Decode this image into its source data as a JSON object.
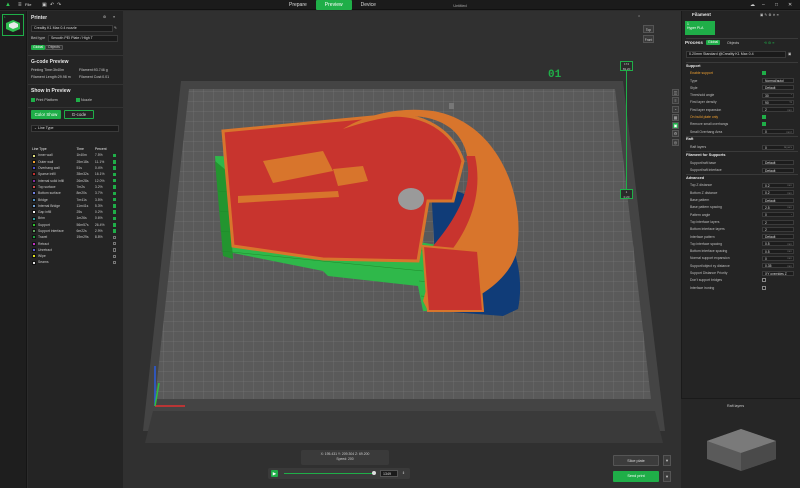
{
  "topbar": {
    "logo": "▲",
    "menu_icon": "≡",
    "file_label": "File",
    "tabs": [
      {
        "label": "Prepare",
        "active": false
      },
      {
        "label": "Preview",
        "active": true
      },
      {
        "label": "Device",
        "active": false
      }
    ],
    "document_title": "Untitled",
    "accent": "#1fae48"
  },
  "left": {
    "plate_thumb_number": "1",
    "printer_title": "Printer",
    "printer_name": "Creality K1 Max 0.4 nozzle",
    "bed_type_label": "Bed type",
    "bed_type_value": "Smooth PEI Plate / High T",
    "global_tab": "Global",
    "objects_tab": "Objects",
    "gcode_title": "G-code Preview",
    "printing_time": "Printing Time:3h40m",
    "filament_weight": "Filament:93.746 g",
    "filament_length": "Filament Length:29.98 m",
    "filament_cost": "Filament Cost:0.01",
    "show_title": "Show in Preview",
    "print_platform": "Print Platform",
    "nozzle": "Nozzle",
    "color_scheme": "Color Show",
    "gcode_btn": "G-code",
    "line_type_label": "Line Type",
    "legend_headers": {
      "type": "Line Type",
      "time": "Time",
      "percent": "Percent"
    },
    "legend": [
      {
        "name": "Inner wall",
        "time": "1h40m",
        "percent": "7.5%",
        "color": "#e0e080",
        "on": true
      },
      {
        "name": "Outer wall",
        "time": "25m18s",
        "percent": "11.1%",
        "color": "#f0a030",
        "on": true
      },
      {
        "name": "Overhang wall",
        "time": "51s",
        "percent": "0.4%",
        "color": "#5050c8",
        "on": true
      },
      {
        "name": "Sparse infill",
        "time": "35m32s",
        "percent": "16.1%",
        "color": "#c03030",
        "on": true
      },
      {
        "name": "Internal solid infill",
        "time": "26m28s",
        "percent": "12.0%",
        "color": "#8030a0",
        "on": true
      },
      {
        "name": "Top surface",
        "time": "7m2s",
        "percent": "3.2%",
        "color": "#d05050",
        "on": true
      },
      {
        "name": "Bottom surface",
        "time": "8m20s",
        "percent": "3.7%",
        "color": "#7080e0",
        "on": true
      },
      {
        "name": "Bridge",
        "time": "7m41s",
        "percent": "3.5%",
        "color": "#5090c0",
        "on": true
      },
      {
        "name": "Internal Bridge",
        "time": "11m41s",
        "percent": "5.3%",
        "color": "#70a0d0",
        "on": true
      },
      {
        "name": "Gap infill",
        "time": "25s",
        "percent": "0.2%",
        "color": "#f0f0f0",
        "on": true
      },
      {
        "name": "Brim",
        "time": "1m26s",
        "percent": "0.6%",
        "color": "#30a0a0",
        "on": true
      },
      {
        "name": "Support",
        "time": "56m57s",
        "percent": "26.4%",
        "color": "#30c030",
        "on": true
      },
      {
        "name": "Support interface",
        "time": "6m22s",
        "percent": "2.9%",
        "color": "#60a060",
        "on": true
      },
      {
        "name": "Travel",
        "time": "19m29s",
        "percent": "8.8%",
        "color": "#20a040",
        "on": false
      },
      {
        "name": "Retract",
        "time": "",
        "percent": "",
        "color": "#c030c0",
        "on": false
      },
      {
        "name": "Unretract",
        "time": "",
        "percent": "",
        "color": "#6060d0",
        "on": false
      },
      {
        "name": "Wipe",
        "time": "",
        "percent": "",
        "color": "#e0e020",
        "on": false
      },
      {
        "name": "Seams",
        "time": "",
        "percent": "",
        "color": "#e0e0e0",
        "on": false
      }
    ]
  },
  "viewport": {
    "plate_number": "01",
    "top_label": "Top",
    "front_label": "Front",
    "layer_top_count": "174",
    "layer_top_height": "69.20",
    "layer_bottom_count": "1",
    "layer_bottom_height": "0.20",
    "coords": "X: 195.431  Y: 209.304  Z: 69.200",
    "speed": "Speed: 200",
    "move_value": "1349",
    "slice_btn": "Slice plate",
    "print_btn": "Send print"
  },
  "right": {
    "filament_title": "Filament",
    "filament_chip_num": "1",
    "filament_chip_name": "Hyper PLA",
    "process_title": "Process",
    "global_tab": "Global",
    "objects_tab": "Objects",
    "process_preset": "0.20mm Standard @Creality K1 Max 0.4",
    "sections": {
      "support": "Support",
      "raft": "Raft",
      "filament_supports": "Filament for Supports",
      "advanced": "Advanced"
    },
    "rows": {
      "enable_support": "Enable support",
      "type": "Type",
      "type_val": "Normal(auto)",
      "style": "Style",
      "style_val": "Default",
      "threshold": "Threshold angle",
      "threshold_val": "30",
      "first_layer_density": "First layer density",
      "first_layer_density_val": "90",
      "first_layer_expansion": "First layer expansion",
      "first_layer_expansion_val": "2",
      "on_build_plate": "On build plate only",
      "remove_small": "Remove small overhangs",
      "small_overhang": "Small Overhang Area",
      "small_overhang_val": "0",
      "raft_layers": "Raft layers",
      "raft_layers_val": "0",
      "support_base": "Support/raft base",
      "support_base_val": "Default",
      "support_interface": "Support/raft interface",
      "support_interface_val": "Default",
      "top_z": "Top Z distance",
      "top_z_val": "0.2",
      "bottom_z": "Bottom Z distance",
      "bottom_z_val": "0.2",
      "base_pattern": "Base pattern",
      "base_pattern_val": "Default",
      "base_spacing": "Base pattern spacing",
      "base_spacing_val": "2.5",
      "pattern_angle": "Pattern angle",
      "pattern_angle_val": "0",
      "top_if_layers": "Top interface layers",
      "top_if_layers_val": "2",
      "bottom_if_layers": "Bottom interface layers",
      "bottom_if_layers_val": "2",
      "if_pattern": "Interface pattern",
      "if_pattern_val": "Default",
      "top_if_spacing": "Top interface spacing",
      "top_if_spacing_val": "0.5",
      "bottom_if_spacing": "Bottom interface spacing",
      "bottom_if_spacing_val": "0.5",
      "normal_expansion": "Normal support expansion",
      "normal_expansion_val": "0",
      "obj_xy": "Support/object xy distance",
      "obj_xy_val": "0.35",
      "dist_priority": "Support Distance Priority",
      "dist_priority_val": "XY overrides Z",
      "dont_bridge": "Don't support bridges",
      "if_ironing": "Interface ironing"
    },
    "raft_panel_title": "Raft layers"
  }
}
